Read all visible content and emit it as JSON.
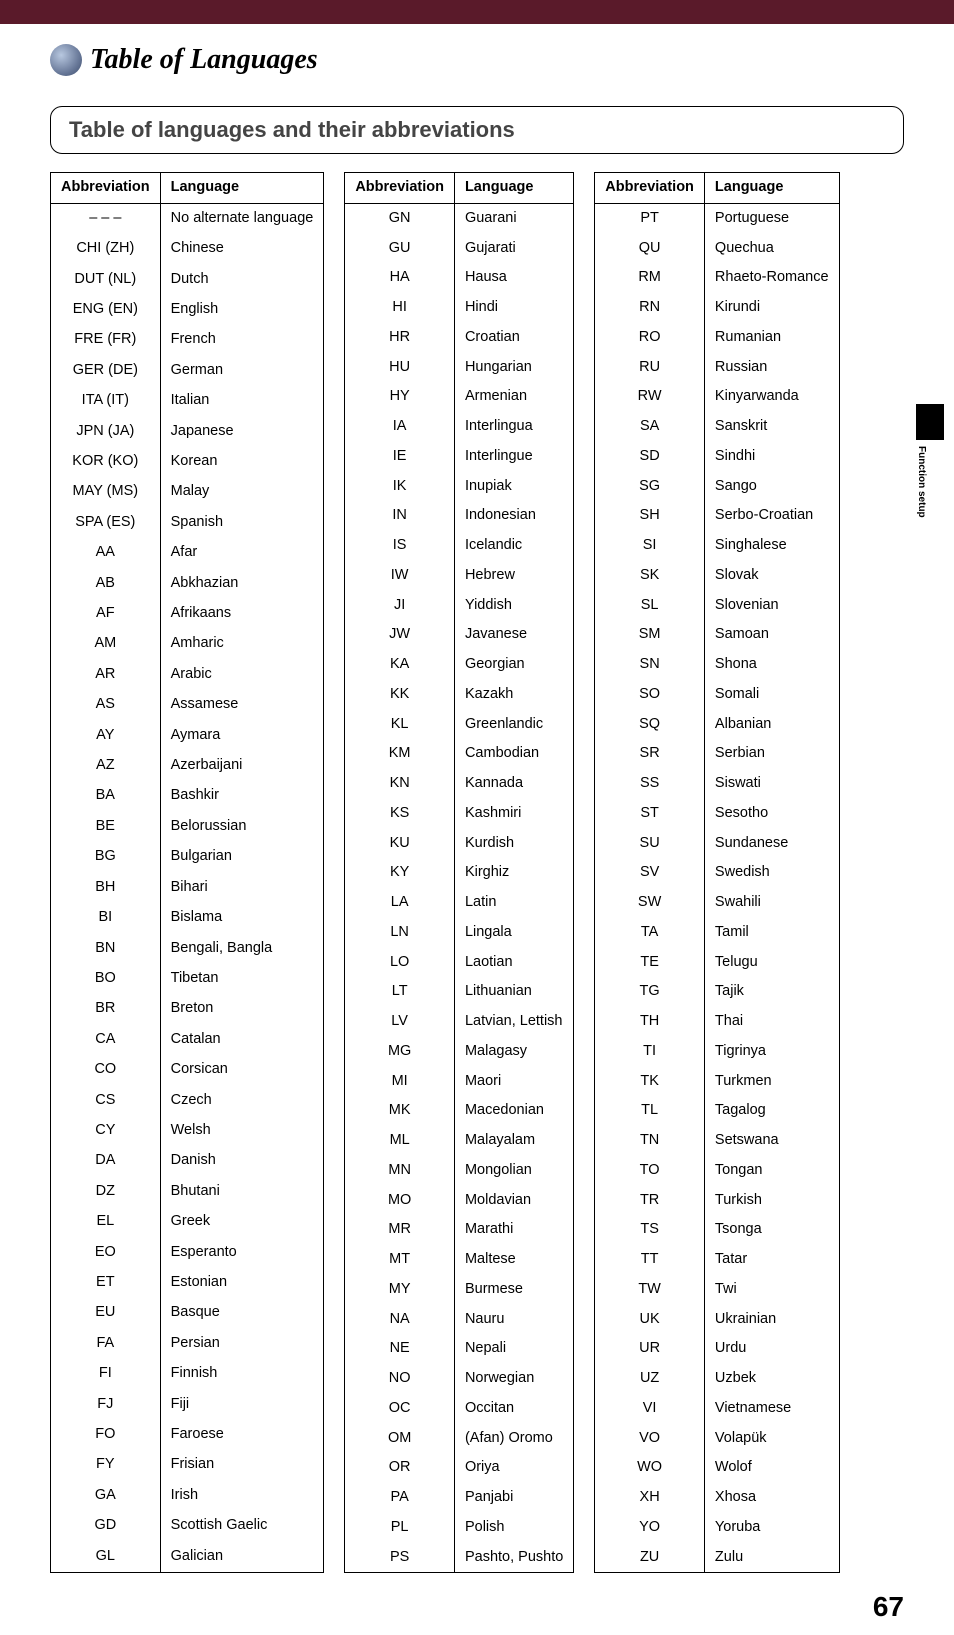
{
  "page_title": "Table of Languages",
  "section_heading": "Table of languages and their abbreviations",
  "col_abbr": "Abbreviation",
  "col_lang": "Language",
  "side_label": "Function setup",
  "page_number": "67",
  "tables": [
    [
      {
        "abbr": "– – –",
        "lang": "No alternate language"
      },
      {
        "abbr": "CHI (ZH)",
        "lang": "Chinese"
      },
      {
        "abbr": "DUT (NL)",
        "lang": "Dutch"
      },
      {
        "abbr": "ENG (EN)",
        "lang": "English"
      },
      {
        "abbr": "FRE (FR)",
        "lang": "French"
      },
      {
        "abbr": "GER (DE)",
        "lang": "German"
      },
      {
        "abbr": "ITA (IT)",
        "lang": "Italian"
      },
      {
        "abbr": "JPN (JA)",
        "lang": "Japanese"
      },
      {
        "abbr": "KOR (KO)",
        "lang": "Korean"
      },
      {
        "abbr": "MAY (MS)",
        "lang": "Malay"
      },
      {
        "abbr": "SPA (ES)",
        "lang": "Spanish"
      },
      {
        "abbr": "AA",
        "lang": "Afar"
      },
      {
        "abbr": "AB",
        "lang": "Abkhazian"
      },
      {
        "abbr": "AF",
        "lang": "Afrikaans"
      },
      {
        "abbr": "AM",
        "lang": "Amharic"
      },
      {
        "abbr": "AR",
        "lang": "Arabic"
      },
      {
        "abbr": "AS",
        "lang": "Assamese"
      },
      {
        "abbr": "AY",
        "lang": "Aymara"
      },
      {
        "abbr": "AZ",
        "lang": "Azerbaijani"
      },
      {
        "abbr": "BA",
        "lang": "Bashkir"
      },
      {
        "abbr": "BE",
        "lang": "Belorussian"
      },
      {
        "abbr": "BG",
        "lang": "Bulgarian"
      },
      {
        "abbr": "BH",
        "lang": "Bihari"
      },
      {
        "abbr": "BI",
        "lang": "Bislama"
      },
      {
        "abbr": "BN",
        "lang": "Bengali, Bangla"
      },
      {
        "abbr": "BO",
        "lang": "Tibetan"
      },
      {
        "abbr": "BR",
        "lang": "Breton"
      },
      {
        "abbr": "CA",
        "lang": "Catalan"
      },
      {
        "abbr": "CO",
        "lang": "Corsican"
      },
      {
        "abbr": "CS",
        "lang": "Czech"
      },
      {
        "abbr": "CY",
        "lang": "Welsh"
      },
      {
        "abbr": "DA",
        "lang": "Danish"
      },
      {
        "abbr": "DZ",
        "lang": "Bhutani"
      },
      {
        "abbr": "EL",
        "lang": "Greek"
      },
      {
        "abbr": "EO",
        "lang": "Esperanto"
      },
      {
        "abbr": "ET",
        "lang": "Estonian"
      },
      {
        "abbr": "EU",
        "lang": "Basque"
      },
      {
        "abbr": "FA",
        "lang": "Persian"
      },
      {
        "abbr": "FI",
        "lang": "Finnish"
      },
      {
        "abbr": "FJ",
        "lang": "Fiji"
      },
      {
        "abbr": "FO",
        "lang": "Faroese"
      },
      {
        "abbr": "FY",
        "lang": "Frisian"
      },
      {
        "abbr": "GA",
        "lang": "Irish"
      },
      {
        "abbr": "GD",
        "lang": "Scottish Gaelic"
      },
      {
        "abbr": "GL",
        "lang": "Galician"
      }
    ],
    [
      {
        "abbr": "GN",
        "lang": "Guarani"
      },
      {
        "abbr": "GU",
        "lang": "Gujarati"
      },
      {
        "abbr": "HA",
        "lang": "Hausa"
      },
      {
        "abbr": "HI",
        "lang": "Hindi"
      },
      {
        "abbr": "HR",
        "lang": "Croatian"
      },
      {
        "abbr": "HU",
        "lang": "Hungarian"
      },
      {
        "abbr": "HY",
        "lang": "Armenian"
      },
      {
        "abbr": "IA",
        "lang": "Interlingua"
      },
      {
        "abbr": "IE",
        "lang": "Interlingue"
      },
      {
        "abbr": "IK",
        "lang": "Inupiak"
      },
      {
        "abbr": "IN",
        "lang": "Indonesian"
      },
      {
        "abbr": "IS",
        "lang": "Icelandic"
      },
      {
        "abbr": "IW",
        "lang": "Hebrew"
      },
      {
        "abbr": "JI",
        "lang": "Yiddish"
      },
      {
        "abbr": "JW",
        "lang": "Javanese"
      },
      {
        "abbr": "KA",
        "lang": "Georgian"
      },
      {
        "abbr": "KK",
        "lang": "Kazakh"
      },
      {
        "abbr": "KL",
        "lang": "Greenlandic"
      },
      {
        "abbr": "KM",
        "lang": "Cambodian"
      },
      {
        "abbr": "KN",
        "lang": "Kannada"
      },
      {
        "abbr": "KS",
        "lang": "Kashmiri"
      },
      {
        "abbr": "KU",
        "lang": "Kurdish"
      },
      {
        "abbr": "KY",
        "lang": "Kirghiz"
      },
      {
        "abbr": "LA",
        "lang": "Latin"
      },
      {
        "abbr": "LN",
        "lang": "Lingala"
      },
      {
        "abbr": "LO",
        "lang": "Laotian"
      },
      {
        "abbr": "LT",
        "lang": "Lithuanian"
      },
      {
        "abbr": "LV",
        "lang": "Latvian, Lettish"
      },
      {
        "abbr": "MG",
        "lang": "Malagasy"
      },
      {
        "abbr": "MI",
        "lang": "Maori"
      },
      {
        "abbr": "MK",
        "lang": "Macedonian"
      },
      {
        "abbr": "ML",
        "lang": "Malayalam"
      },
      {
        "abbr": "MN",
        "lang": "Mongolian"
      },
      {
        "abbr": "MO",
        "lang": "Moldavian"
      },
      {
        "abbr": "MR",
        "lang": "Marathi"
      },
      {
        "abbr": "MT",
        "lang": "Maltese"
      },
      {
        "abbr": "MY",
        "lang": "Burmese"
      },
      {
        "abbr": "NA",
        "lang": "Nauru"
      },
      {
        "abbr": "NE",
        "lang": "Nepali"
      },
      {
        "abbr": "NO",
        "lang": "Norwegian"
      },
      {
        "abbr": "OC",
        "lang": "Occitan"
      },
      {
        "abbr": "OM",
        "lang": "(Afan) Oromo"
      },
      {
        "abbr": "OR",
        "lang": "Oriya"
      },
      {
        "abbr": "PA",
        "lang": "Panjabi"
      },
      {
        "abbr": "PL",
        "lang": "Polish"
      },
      {
        "abbr": "PS",
        "lang": "Pashto, Pushto"
      }
    ],
    [
      {
        "abbr": "PT",
        "lang": "Portuguese"
      },
      {
        "abbr": "QU",
        "lang": "Quechua"
      },
      {
        "abbr": "RM",
        "lang": "Rhaeto-Romance"
      },
      {
        "abbr": "RN",
        "lang": "Kirundi"
      },
      {
        "abbr": "RO",
        "lang": "Rumanian"
      },
      {
        "abbr": "RU",
        "lang": "Russian"
      },
      {
        "abbr": "RW",
        "lang": "Kinyarwanda"
      },
      {
        "abbr": "SA",
        "lang": "Sanskrit"
      },
      {
        "abbr": "SD",
        "lang": "Sindhi"
      },
      {
        "abbr": "SG",
        "lang": "Sango"
      },
      {
        "abbr": "SH",
        "lang": "Serbo-Croatian"
      },
      {
        "abbr": "SI",
        "lang": "Singhalese"
      },
      {
        "abbr": "SK",
        "lang": "Slovak"
      },
      {
        "abbr": "SL",
        "lang": "Slovenian"
      },
      {
        "abbr": "SM",
        "lang": "Samoan"
      },
      {
        "abbr": "SN",
        "lang": "Shona"
      },
      {
        "abbr": "SO",
        "lang": "Somali"
      },
      {
        "abbr": "SQ",
        "lang": "Albanian"
      },
      {
        "abbr": "SR",
        "lang": "Serbian"
      },
      {
        "abbr": "SS",
        "lang": "Siswati"
      },
      {
        "abbr": "ST",
        "lang": "Sesotho"
      },
      {
        "abbr": "SU",
        "lang": "Sundanese"
      },
      {
        "abbr": "SV",
        "lang": "Swedish"
      },
      {
        "abbr": "SW",
        "lang": "Swahili"
      },
      {
        "abbr": "TA",
        "lang": "Tamil"
      },
      {
        "abbr": "TE",
        "lang": "Telugu"
      },
      {
        "abbr": "TG",
        "lang": "Tajik"
      },
      {
        "abbr": "TH",
        "lang": "Thai"
      },
      {
        "abbr": "TI",
        "lang": "Tigrinya"
      },
      {
        "abbr": "TK",
        "lang": "Turkmen"
      },
      {
        "abbr": "TL",
        "lang": "Tagalog"
      },
      {
        "abbr": "TN",
        "lang": "Setswana"
      },
      {
        "abbr": "TO",
        "lang": "Tongan"
      },
      {
        "abbr": "TR",
        "lang": "Turkish"
      },
      {
        "abbr": "TS",
        "lang": "Tsonga"
      },
      {
        "abbr": "TT",
        "lang": "Tatar"
      },
      {
        "abbr": "TW",
        "lang": "Twi"
      },
      {
        "abbr": "UK",
        "lang": "Ukrainian"
      },
      {
        "abbr": "UR",
        "lang": "Urdu"
      },
      {
        "abbr": "UZ",
        "lang": "Uzbek"
      },
      {
        "abbr": "VI",
        "lang": "Vietnamese"
      },
      {
        "abbr": "VO",
        "lang": "Volapük"
      },
      {
        "abbr": "WO",
        "lang": "Wolof"
      },
      {
        "abbr": "XH",
        "lang": "Xhosa"
      },
      {
        "abbr": "YO",
        "lang": "Yoruba"
      },
      {
        "abbr": "ZU",
        "lang": "Zulu"
      }
    ]
  ]
}
